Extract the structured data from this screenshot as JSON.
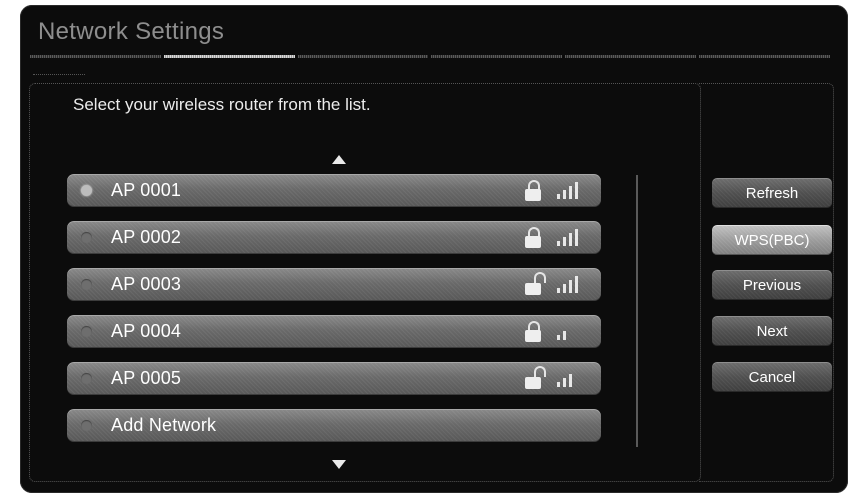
{
  "window": {
    "title": "Network Settings"
  },
  "progress": {
    "steps": 6,
    "active_step": 2
  },
  "main": {
    "instruction": "Select your wireless router from the list.",
    "scroll_up_icon": "triangle-up-icon",
    "scroll_down_icon": "triangle-down-icon"
  },
  "networks": [
    {
      "label": "AP 0001",
      "selected": true,
      "locked": true,
      "signal": 4
    },
    {
      "label": "AP 0002",
      "selected": false,
      "locked": true,
      "signal": 4
    },
    {
      "label": "AP 0003",
      "selected": false,
      "locked": false,
      "signal": 4
    },
    {
      "label": "AP 0004",
      "selected": false,
      "locked": true,
      "signal": 2
    },
    {
      "label": "AP 0005",
      "selected": false,
      "locked": false,
      "signal": 3
    },
    {
      "label": "Add Network",
      "selected": false,
      "locked": null,
      "signal": null
    }
  ],
  "buttons": {
    "refresh": "Refresh",
    "wps": "WPS(PBC)",
    "previous": "Previous",
    "next": "Next",
    "cancel": "Cancel"
  },
  "colors": {
    "background": "#0c0c0c",
    "focus": "#a8a8a8",
    "text": "#ffffff"
  }
}
